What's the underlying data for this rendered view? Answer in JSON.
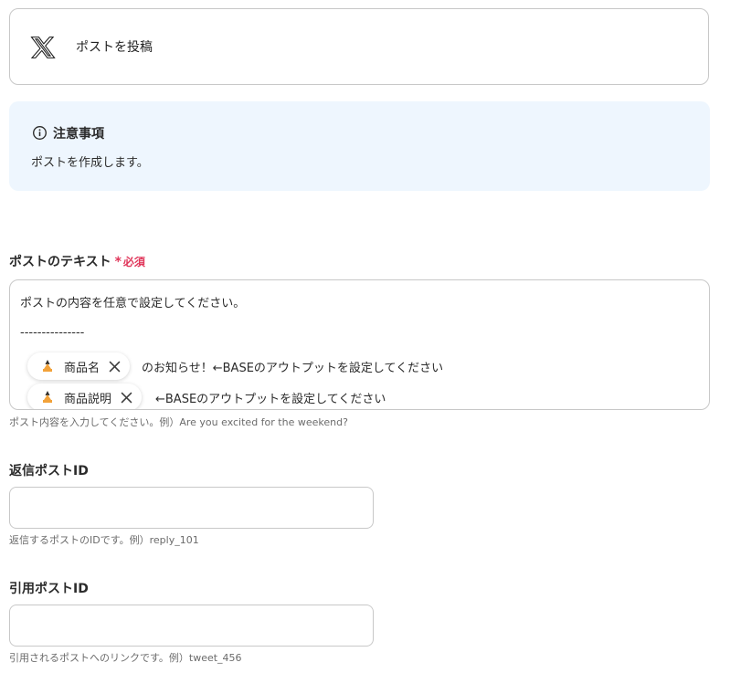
{
  "header": {
    "title": "ポストを投稿",
    "icon": "x-logo-icon"
  },
  "notice": {
    "title": "注意事項",
    "body": "ポストを作成します。",
    "icon": "info-icon",
    "bg": "#eef6fe"
  },
  "post_text": {
    "label": "ポストのテキスト",
    "required_mark": "*",
    "required_text": "必須",
    "lines": [
      "ポストの内容を任意で設定してください。",
      "---------------"
    ],
    "chips": [
      {
        "label": "商品名",
        "icon": "base-logo-icon",
        "suffix": "のお知らせ！←BASEのアウトプットを設定してください"
      },
      {
        "label": "商品説明",
        "icon": "base-logo-icon",
        "suffix": "←BASEのアウトプットを設定してください"
      }
    ],
    "hint": "ポスト内容を入力してください。例）Are you excited for the weekend?"
  },
  "reply_id": {
    "label": "返信ポストID",
    "value": "",
    "hint": "返信するポストのIDです。例）reply_101"
  },
  "quote_id": {
    "label": "引用ポストID",
    "value": "",
    "hint": "引用されるポストへのリンクです。例）tweet_456"
  },
  "colors": {
    "required": "#e0365a",
    "border": "#c8c8c8",
    "hint": "#6b6b6b"
  }
}
